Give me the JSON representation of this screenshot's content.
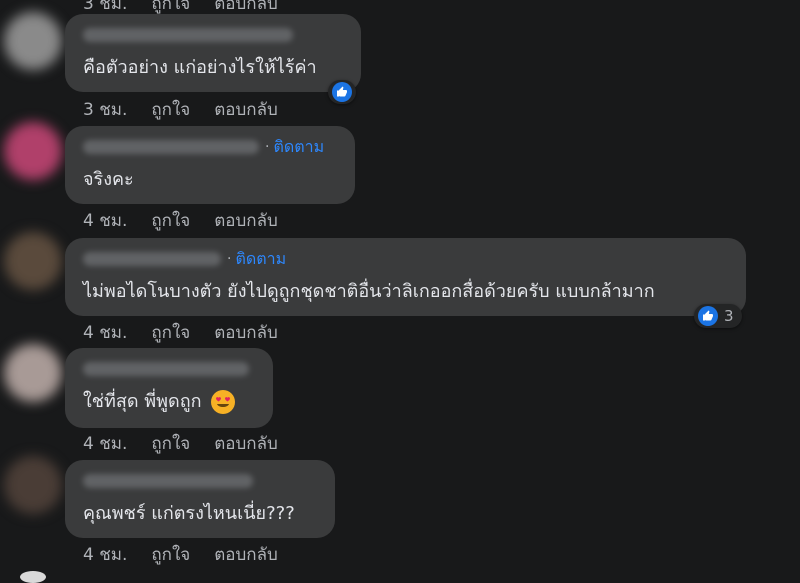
{
  "top_actions": {
    "time": "3 ชม.",
    "like": "ถูกใจ",
    "reply": "ตอบกลับ"
  },
  "comments": [
    {
      "text": "คือตัวอย่าง แก่อย่างไรให้ไร้ค่า",
      "follow": "",
      "time": "3 ชม.",
      "like": "ถูกใจ",
      "reply": "ตอบกลับ",
      "reaction_count": ""
    },
    {
      "text": "จริงคะ",
      "follow": "ติดตาม",
      "time": "4 ชม.",
      "like": "ถูกใจ",
      "reply": "ตอบกลับ",
      "reaction_count": ""
    },
    {
      "text": "ไม่พอไดโนบางตัว ยังไปดูถูกชุดชาติอื่นว่าลิเกออกสื่อด้วยครับ แบบกล้ามาก",
      "follow": "ติดตาม",
      "time": "4 ชม.",
      "like": "ถูกใจ",
      "reply": "ตอบกลับ",
      "reaction_count": "3"
    },
    {
      "text": "ใช่ที่สุด พี่พูดถูก",
      "follow": "",
      "time": "4 ชม.",
      "like": "ถูกใจ",
      "reply": "ตอบกลับ",
      "reaction_count": ""
    },
    {
      "text": "คุณพชร์ แก่ตรงไหนเนี่ย???",
      "follow": "",
      "time": "4 ชม.",
      "like": "ถูกใจ",
      "reply": "ตอบกลับ",
      "reaction_count": ""
    }
  ],
  "colors": {
    "background": "#18191a",
    "bubble": "#3a3b3c",
    "link": "#2d88ff",
    "like": "#1b74e4",
    "secondary_text": "#b0b3b8"
  },
  "icons": [
    "like-icon",
    "heart-eyes-emoji"
  ]
}
